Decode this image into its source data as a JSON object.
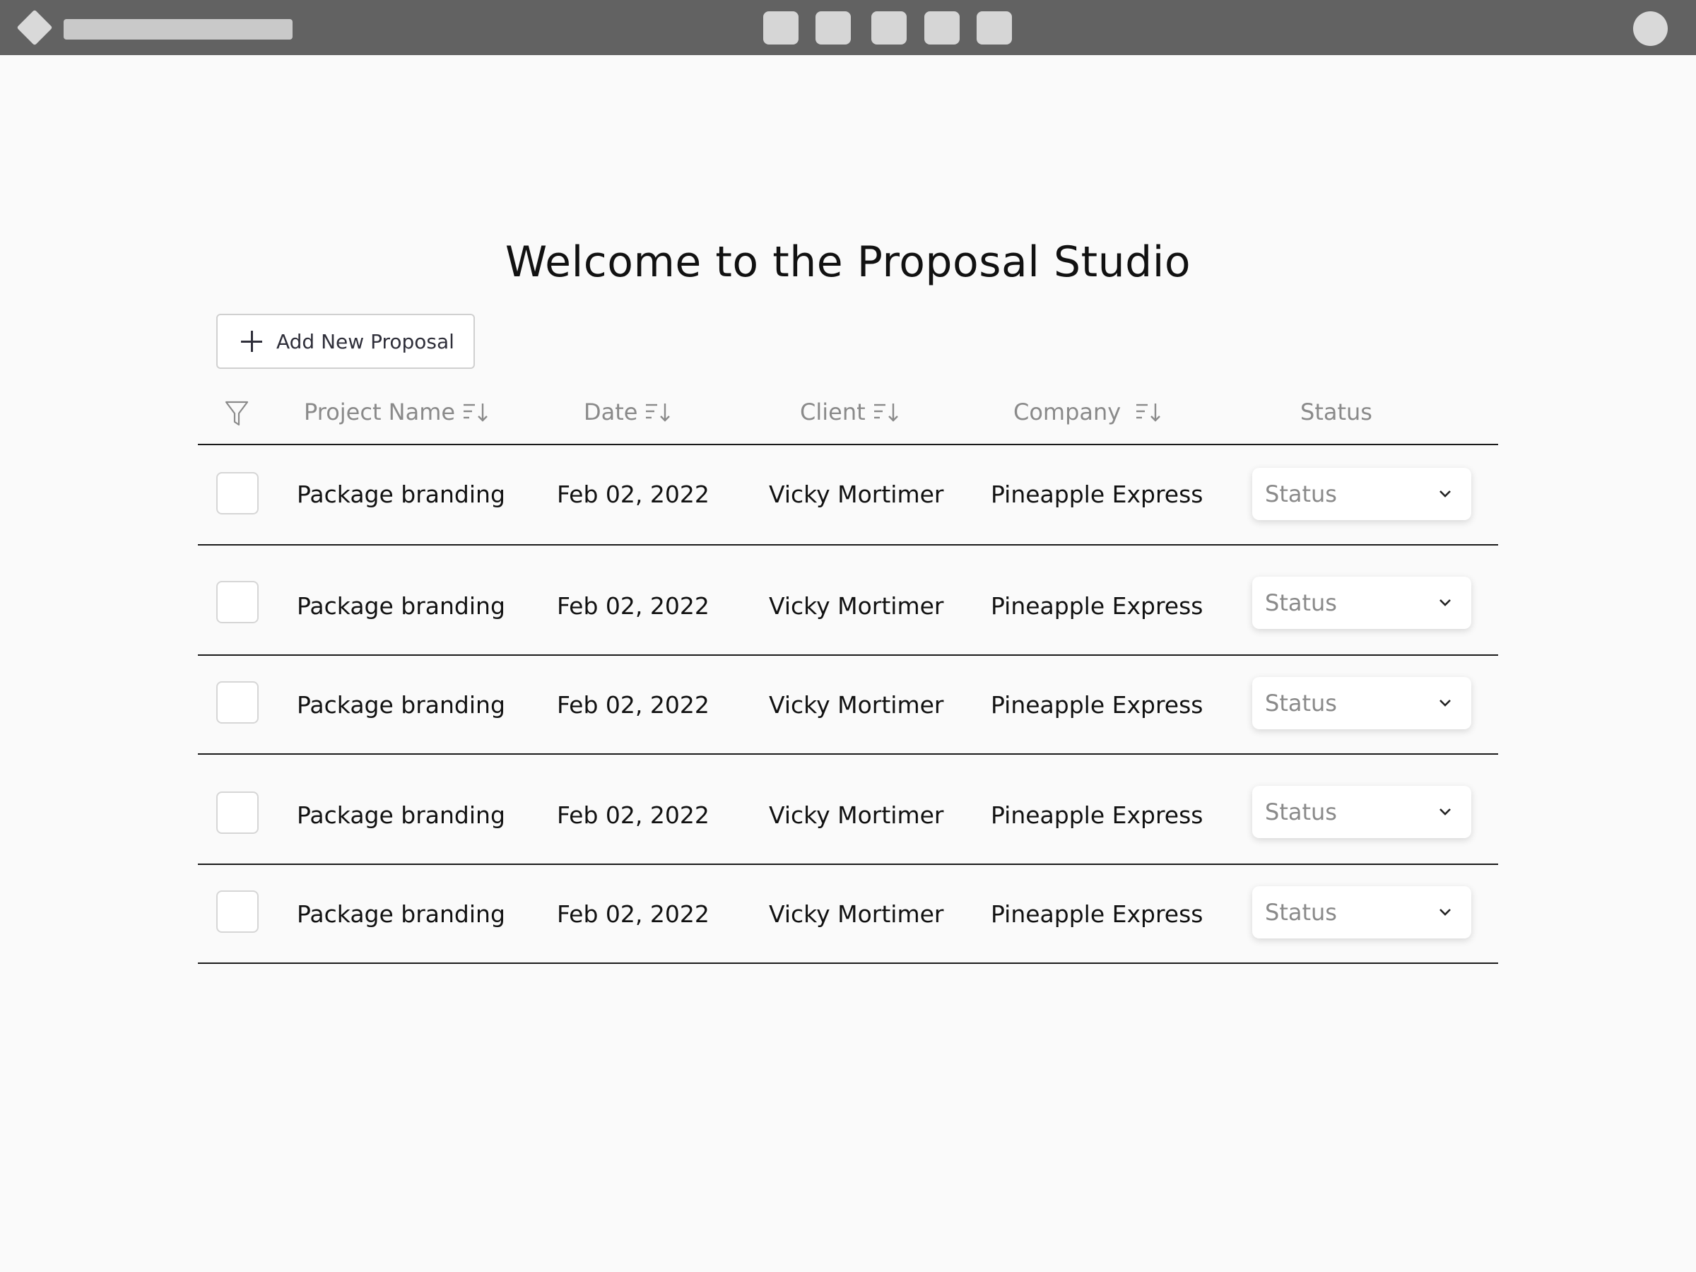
{
  "header": {
    "toolbar_buttons": 5
  },
  "main": {
    "title": "Welcome to the Proposal Studio",
    "add_button_label": "Add New Proposal"
  },
  "table": {
    "columns": [
      {
        "label": "Project Name",
        "sortable": true
      },
      {
        "label": "Date",
        "sortable": true
      },
      {
        "label": "Client",
        "sortable": true
      },
      {
        "label": "Company",
        "sortable": true
      },
      {
        "label": "Status",
        "sortable": false
      }
    ],
    "rows": [
      {
        "project": "Package branding",
        "date": "Feb 02, 2022",
        "client": "Vicky Mortimer",
        "company": "Pineapple Express",
        "status": "Status"
      },
      {
        "project": "Package branding",
        "date": "Feb 02, 2022",
        "client": "Vicky Mortimer",
        "company": "Pineapple Express",
        "status": "Status"
      },
      {
        "project": "Package branding",
        "date": "Feb 02, 2022",
        "client": "Vicky Mortimer",
        "company": "Pineapple Express",
        "status": "Status"
      },
      {
        "project": "Package branding",
        "date": "Feb 02, 2022",
        "client": "Vicky Mortimer",
        "company": "Pineapple Express",
        "status": "Status"
      },
      {
        "project": "Package branding",
        "date": "Feb 02, 2022",
        "client": "Vicky Mortimer",
        "company": "Pineapple Express",
        "status": "Status"
      }
    ]
  },
  "colors": {
    "topbar": "#626262",
    "background": "#fafafa",
    "header_text": "#8a8a8a",
    "row_divider": "#1a1a1a"
  }
}
